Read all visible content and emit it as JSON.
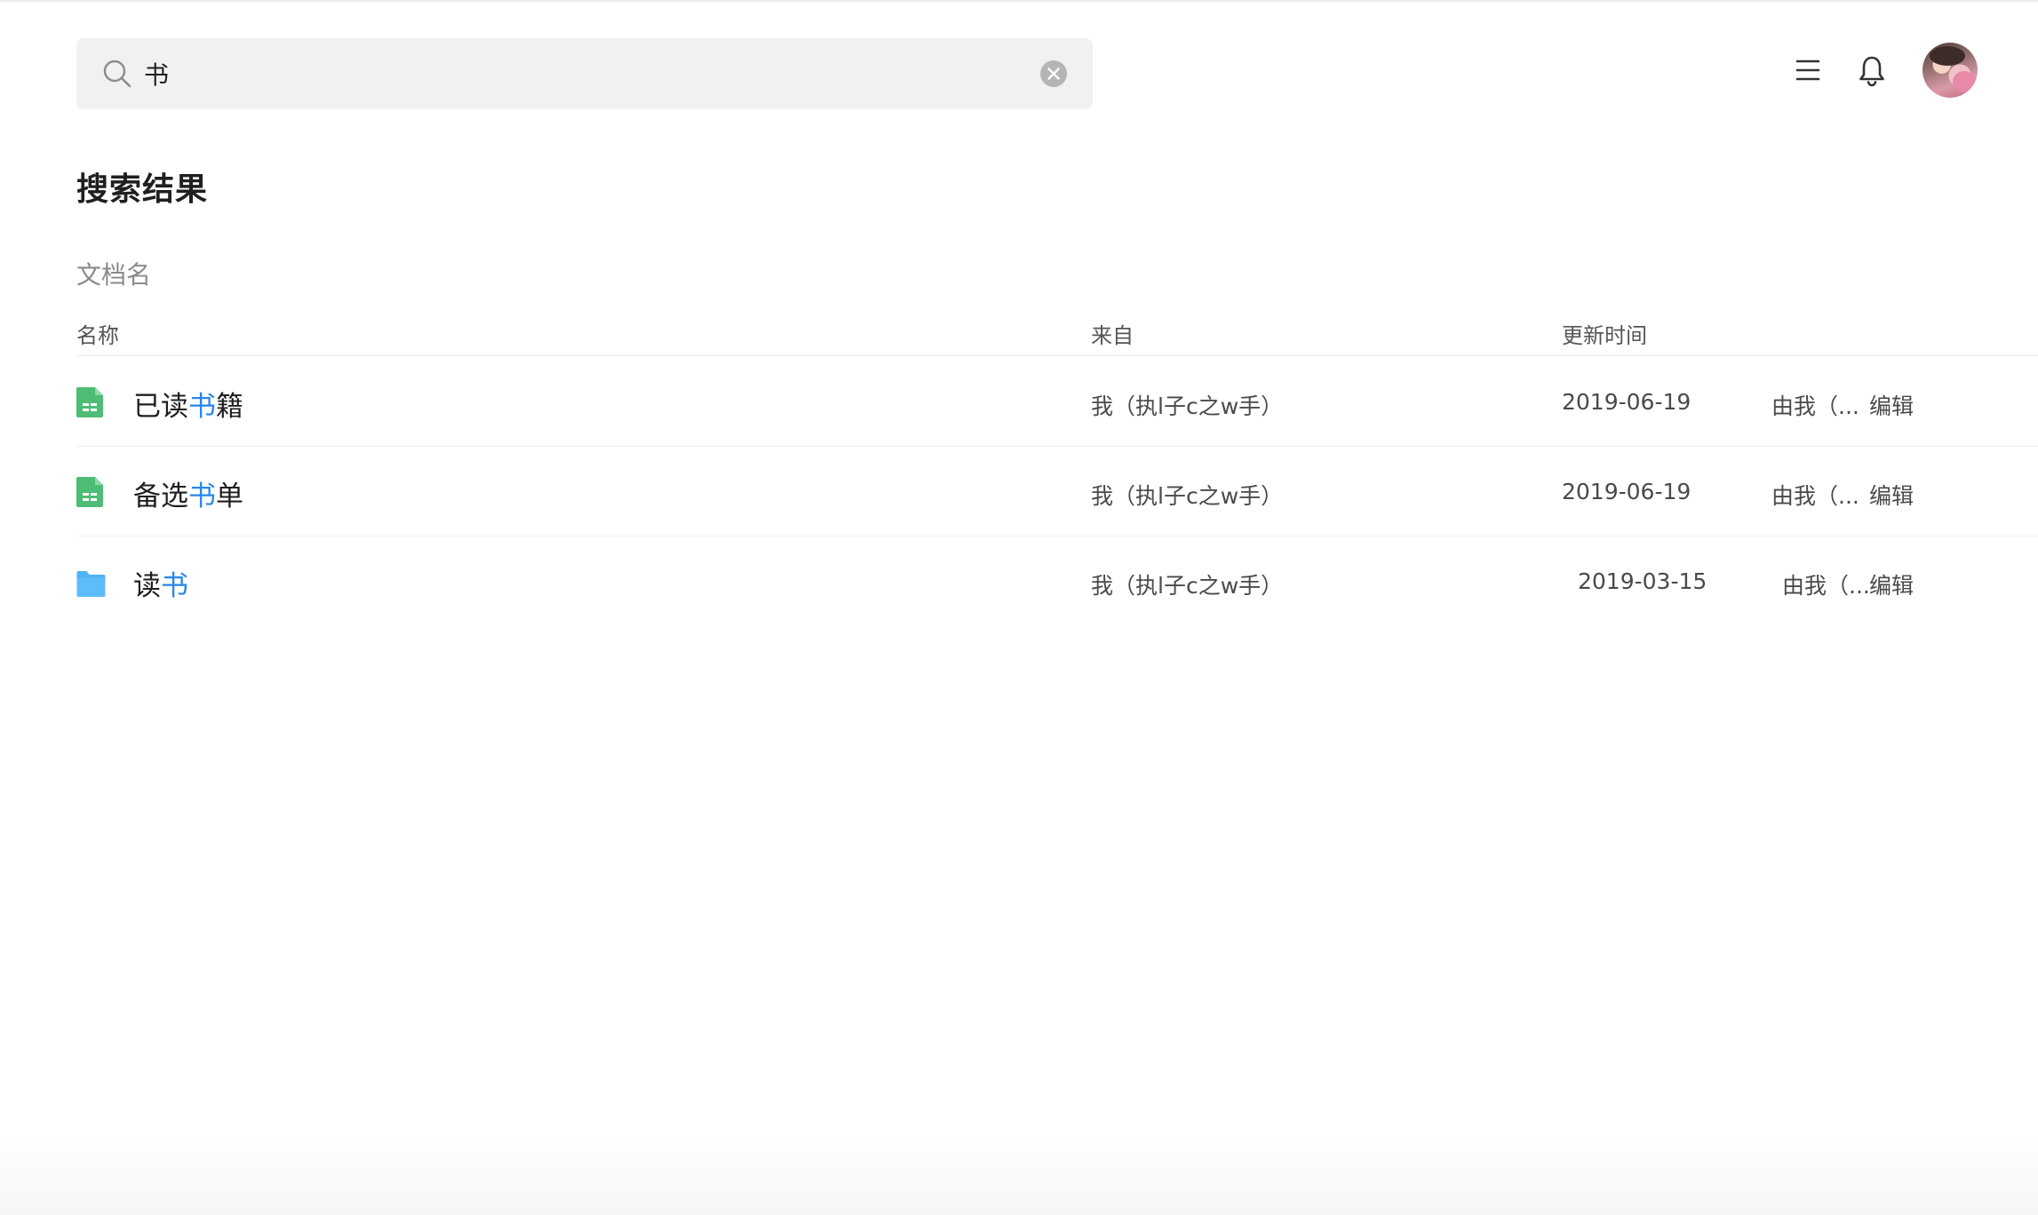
{
  "search": {
    "value": "书",
    "placeholder": ""
  },
  "page_title": "搜索结果",
  "section_title": "文档名",
  "table": {
    "columns": {
      "name": "名称",
      "from": "来自",
      "updated": "更新时间"
    },
    "rows": [
      {
        "icon": "spreadsheet-icon",
        "name_before": "已读",
        "name_highlight": "书",
        "name_after": "籍",
        "from": "我（执l子c之w手）",
        "date": "2019-06-19",
        "editor": "由我（...",
        "action": "编辑"
      },
      {
        "icon": "spreadsheet-icon",
        "name_before": "备选",
        "name_highlight": "书",
        "name_after": "单",
        "from": "我（执l子c之w手）",
        "date": "2019-06-19",
        "editor": "由我（...",
        "action": "编辑"
      },
      {
        "icon": "folder-icon",
        "name_before": "读",
        "name_highlight": "书",
        "name_after": "",
        "from": "我（执l子c之w手）",
        "date": "2019-03-15",
        "editor": "由我（...",
        "action": "编辑"
      }
    ]
  },
  "colors": {
    "highlight": "#2a86ea",
    "sheet_green": "#4dbd74",
    "folder_blue": "#4fb3f6",
    "search_bg": "#f1f1f1"
  }
}
